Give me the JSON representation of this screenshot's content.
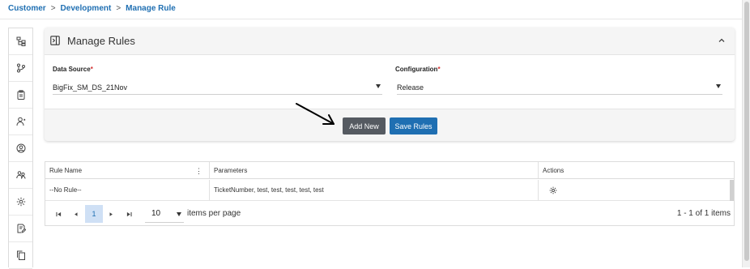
{
  "breadcrumb": {
    "items": [
      "Customer",
      "Development",
      "Manage Rule"
    ],
    "separator": ">"
  },
  "sidebar": {
    "items": [
      {
        "icon": "hierarchy-icon"
      },
      {
        "icon": "workflow-icon"
      },
      {
        "icon": "clipboard-icon"
      },
      {
        "icon": "user-icon"
      },
      {
        "icon": "user-circle-icon"
      },
      {
        "icon": "users-icon"
      },
      {
        "icon": "settings-icon"
      },
      {
        "icon": "document-edit-icon"
      },
      {
        "icon": "copy-icon"
      }
    ]
  },
  "panel": {
    "title": "Manage Rules",
    "data_source": {
      "label": "Data Source",
      "required_mark": "*",
      "value": "BigFix_SM_DS_21Nov"
    },
    "configuration": {
      "label": "Configuration",
      "required_mark": "*",
      "value": "Release"
    },
    "buttons": {
      "add_new": "Add New",
      "save_rules": "Save Rules"
    }
  },
  "grid": {
    "columns": [
      "Rule Name",
      "Parameters",
      "Actions"
    ],
    "column_menu": "⋮",
    "rows": [
      {
        "rule_name": "--No Rule--",
        "parameters": "TicketNumber, test, test, test, test, test",
        "action_icon": "gear-icon"
      }
    ]
  },
  "pagination": {
    "current_page": "1",
    "page_size": "10",
    "items_per_page_label": "items per page",
    "range_info": "1 - 1 of 1 items"
  },
  "colors": {
    "accent": "#1f6fb2",
    "add_button": "#555a61",
    "panel_bg": "#f5f5f5",
    "required": "#d32f2f"
  }
}
